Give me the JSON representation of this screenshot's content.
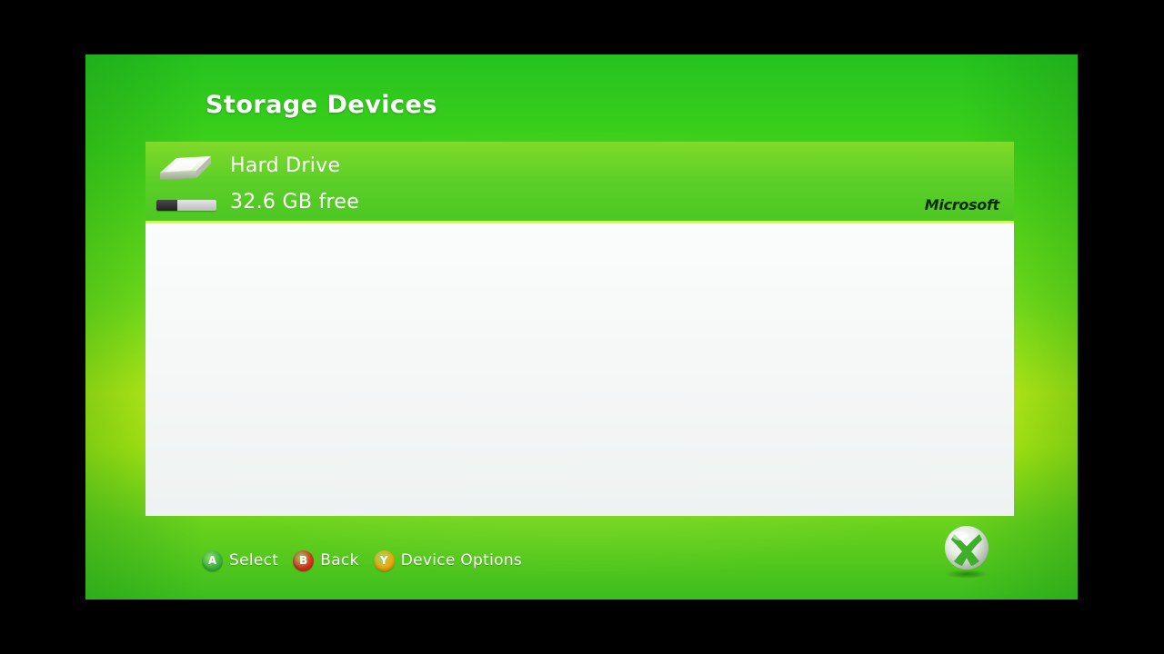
{
  "page": {
    "title": "Storage Devices"
  },
  "devices": [
    {
      "name": "Hard Drive",
      "free_label": "32.6 GB free",
      "manufacturer": "Microsoft",
      "used_fraction": 0.35,
      "icon": "hard-drive-icon"
    }
  ],
  "buttons": [
    {
      "glyph": "A",
      "label": "Select",
      "color": "#3cb53a"
    },
    {
      "glyph": "B",
      "label": "Back",
      "color": "#d9311f"
    },
    {
      "glyph": "Y",
      "label": "Device Options",
      "color": "#f2a60c"
    }
  ],
  "colors": {
    "background_green": "#3fd21a",
    "highlight_green": "#5ccf28",
    "list_white": "#f7faf9"
  },
  "logo_icon": "xbox-logo-icon"
}
